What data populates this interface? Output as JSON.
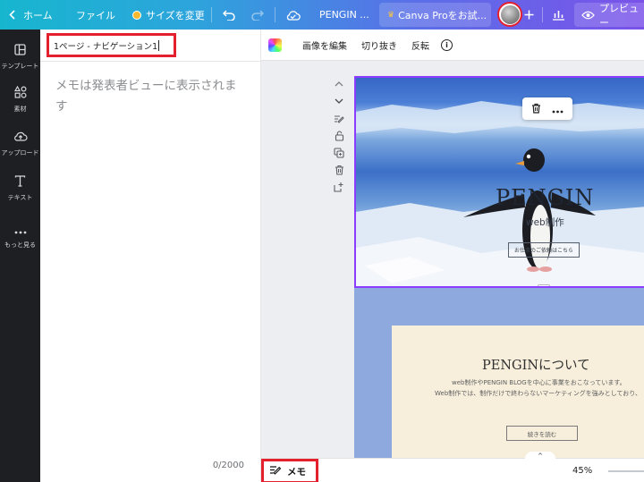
{
  "topbar": {
    "home_label": "ホーム",
    "file_label": "ファイル",
    "resize_label": "サイズを変更",
    "design_title": "PENGIN ...",
    "pro_label": "Canva Proをお試...",
    "preview_label": "プレビュー",
    "icons": [
      "chevron-left-icon",
      "undo-icon",
      "redo-icon",
      "cloud-sync-icon",
      "plus-icon",
      "chart-icon",
      "eye-icon"
    ]
  },
  "sidebar": {
    "items": [
      {
        "label": "テンプレート",
        "icon": "template-icon"
      },
      {
        "label": "素材",
        "icon": "elements-icon"
      },
      {
        "label": "アップロード",
        "icon": "upload-icon"
      },
      {
        "label": "テキスト",
        "icon": "text-icon"
      },
      {
        "label": "もっと見る",
        "icon": "more-icon"
      }
    ]
  },
  "notes": {
    "page_title_value": "1ページ - ナビゲーション1",
    "placeholder": "メモは発表者ビューに表示されます",
    "char_count": "0/2000"
  },
  "editor_toolbar": {
    "edit_image": "画像を編集",
    "crop": "切り抜き",
    "flip": "反転"
  },
  "canvas": {
    "page1": {
      "title": "PENGIN",
      "subtitle": "web制作",
      "button": "お仕事のご依頼はこちら"
    },
    "page2": {
      "title": "PENGINについて",
      "line1": "web制作やPENGIN BLOGを中心に事業をおこなっています。",
      "line2": "Web制作では、制作だけで終わらないマーケティングを強みとしており、",
      "button": "続きを読む"
    }
  },
  "bottombar": {
    "memo_label": "メモ",
    "zoom": "45%"
  },
  "colors": {
    "accent_red": "#e4202f",
    "selection_purple": "#8b3dff",
    "sidebar_bg": "#1d1f22"
  }
}
